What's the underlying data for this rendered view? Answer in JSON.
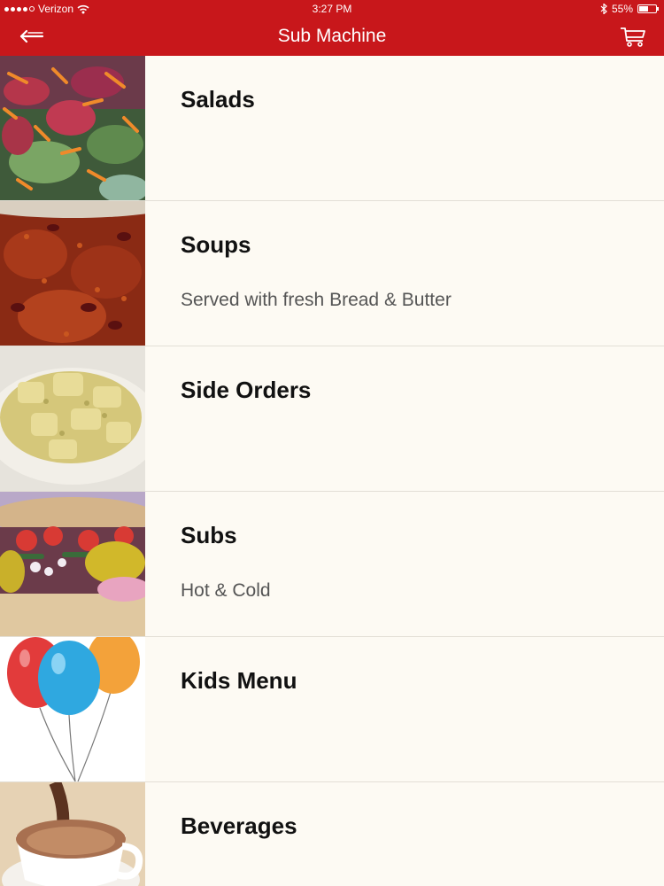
{
  "status_bar": {
    "carrier": "Verizon",
    "time": "3:27 PM",
    "battery": "55%",
    "battery_level": 0.55
  },
  "header": {
    "title": "Sub Machine",
    "back_icon": "back-arrow-icon",
    "cart_icon": "cart-icon"
  },
  "colors": {
    "header_bg": "#c8171b",
    "list_bg": "#fdfaf3"
  },
  "menu": [
    {
      "title": "Salads",
      "subtitle": "",
      "image": "salad-photo"
    },
    {
      "title": "Soups",
      "subtitle": "Served with fresh Bread & Butter",
      "image": "chili-soup-photo"
    },
    {
      "title": "Side Orders",
      "subtitle": "",
      "image": "potato-salad-photo"
    },
    {
      "title": "Subs",
      "subtitle": "Hot & Cold",
      "image": "sub-sandwich-photo"
    },
    {
      "title": "Kids Menu",
      "subtitle": "",
      "image": "balloons-photo"
    },
    {
      "title": "Beverages",
      "subtitle": "",
      "image": "hot-chocolate-photo"
    }
  ]
}
